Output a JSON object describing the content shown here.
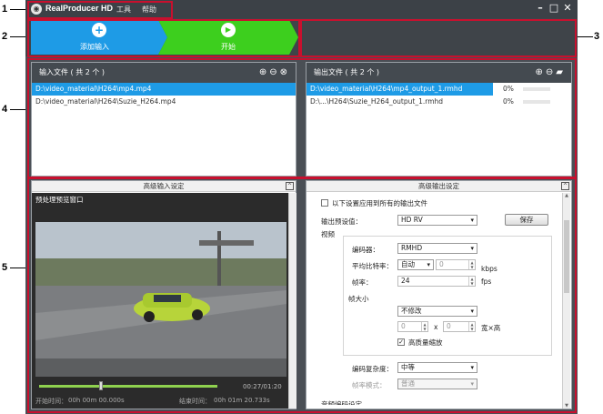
{
  "annotations": [
    "1",
    "2",
    "3",
    "4",
    "5"
  ],
  "app": {
    "title": "RealProducer HD",
    "menu": [
      "工具",
      "帮助"
    ],
    "window_controls": [
      "minimize-icon",
      "maximize-icon",
      "close-icon"
    ]
  },
  "toolbar": {
    "add_label": "添加输入",
    "start_label": "开始",
    "add_color": "#1e9be6",
    "start_color": "#3dcf1e"
  },
  "input_panel": {
    "title": "输入文件 ( 共 2 个 )",
    "files": [
      "D:\\video_material\\H264\\mp4.mp4",
      "D:\\video_material\\H264\\Suzie_H264.mp4"
    ]
  },
  "output_panel": {
    "title": "输出文件 ( 共 2 个 )",
    "files": [
      {
        "path": "D:\\video_material\\H264\\mp4_output_1.rmhd",
        "progress": "0%"
      },
      {
        "path": "D:\\...\\H264\\Suzie_H264_output_1.rmhd",
        "progress": "0%"
      }
    ]
  },
  "adv_input": {
    "title": "高级输入设定",
    "preview_label": "预处理预览窗口",
    "time_display": "00:27/01:20",
    "start_time_label": "开始时间：",
    "start_time": "00h 00m 00.000s",
    "end_time_label": "结束时间：",
    "end_time": "00h 01m 20.733s"
  },
  "adv_output": {
    "title": "高级输出设定",
    "apply_all_label": "以下设置应用到所有的输出文件",
    "preset_label": "输出预设值：",
    "preset_value": "HD RV",
    "save_button": "保存",
    "video_section": "视频",
    "codec_label": "编码器：",
    "codec_value": "RMHD",
    "bitrate_label": "平均比特率：",
    "bitrate_mode": "自动",
    "bitrate_value": "0",
    "bitrate_unit": "kbps",
    "fps_label": "帧率：",
    "fps_value": "24",
    "fps_unit": "fps",
    "frame_size_label": "帧大小",
    "frame_size_value": "不修改",
    "width_value": "0",
    "height_value": "0",
    "x_sep": "x",
    "wh_label": "宽×高",
    "hq_scale_label": "高质量缩放",
    "complexity_label": "编码复杂度：",
    "complexity_value": "中等",
    "rate_mode_label": "帧率模式：",
    "rate_mode_value": "普通",
    "more_label": "音频编码设定"
  }
}
